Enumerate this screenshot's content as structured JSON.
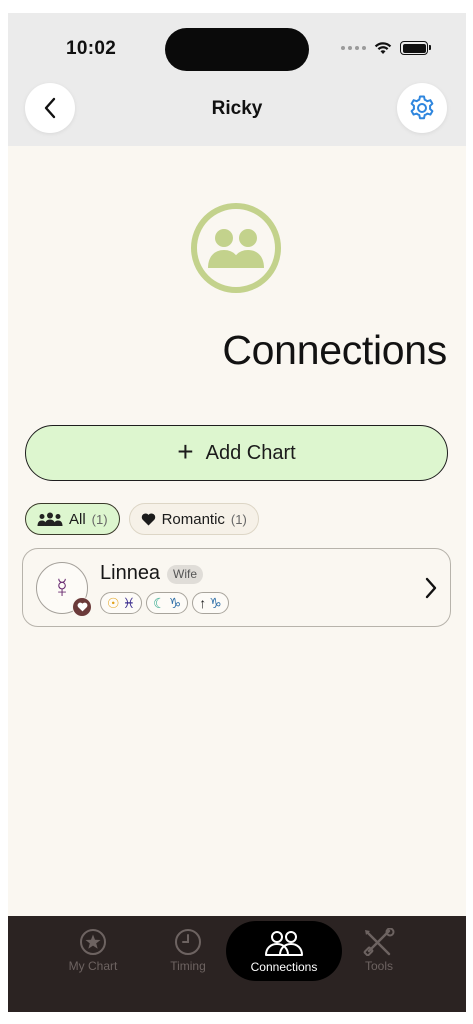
{
  "status_bar": {
    "time": "10:02"
  },
  "header": {
    "title": "Ricky",
    "back_icon": "chevron-left-icon",
    "settings_icon": "gear-icon"
  },
  "page": {
    "icon": "connections-icon",
    "title": "Connections"
  },
  "add_chart": {
    "label": "Add Chart",
    "icon": "plus-icon"
  },
  "filters": [
    {
      "label": "All",
      "count": "(1)",
      "icon": "group-icon",
      "active": true
    },
    {
      "label": "Romantic",
      "count": "(1)",
      "icon": "heart-icon",
      "active": false
    }
  ],
  "connections": [
    {
      "name": "Linnea",
      "relation": "Wife",
      "avatar_glyph": "☿",
      "placements": [
        {
          "label": "Sun",
          "symbol": "☉",
          "sign": "♓"
        },
        {
          "label": "Moon",
          "symbol": "☾",
          "sign": "♑"
        },
        {
          "label": "Rising",
          "symbol": "↑",
          "sign": "♑"
        }
      ]
    }
  ],
  "tabbar": {
    "items": [
      {
        "label": "My Chart",
        "icon": "star-circle-icon"
      },
      {
        "label": "Timing",
        "icon": "clock-icon"
      },
      {
        "label": "Connections",
        "icon": "people-icon",
        "active": true
      },
      {
        "label": "Tools",
        "icon": "tools-icon"
      }
    ]
  },
  "colors": {
    "accent_green": "#ddf6cf",
    "icon_green": "#c3d28c",
    "settings_blue": "#2f86de",
    "background": "#faf7f1",
    "tabbar": "#2b2322"
  }
}
